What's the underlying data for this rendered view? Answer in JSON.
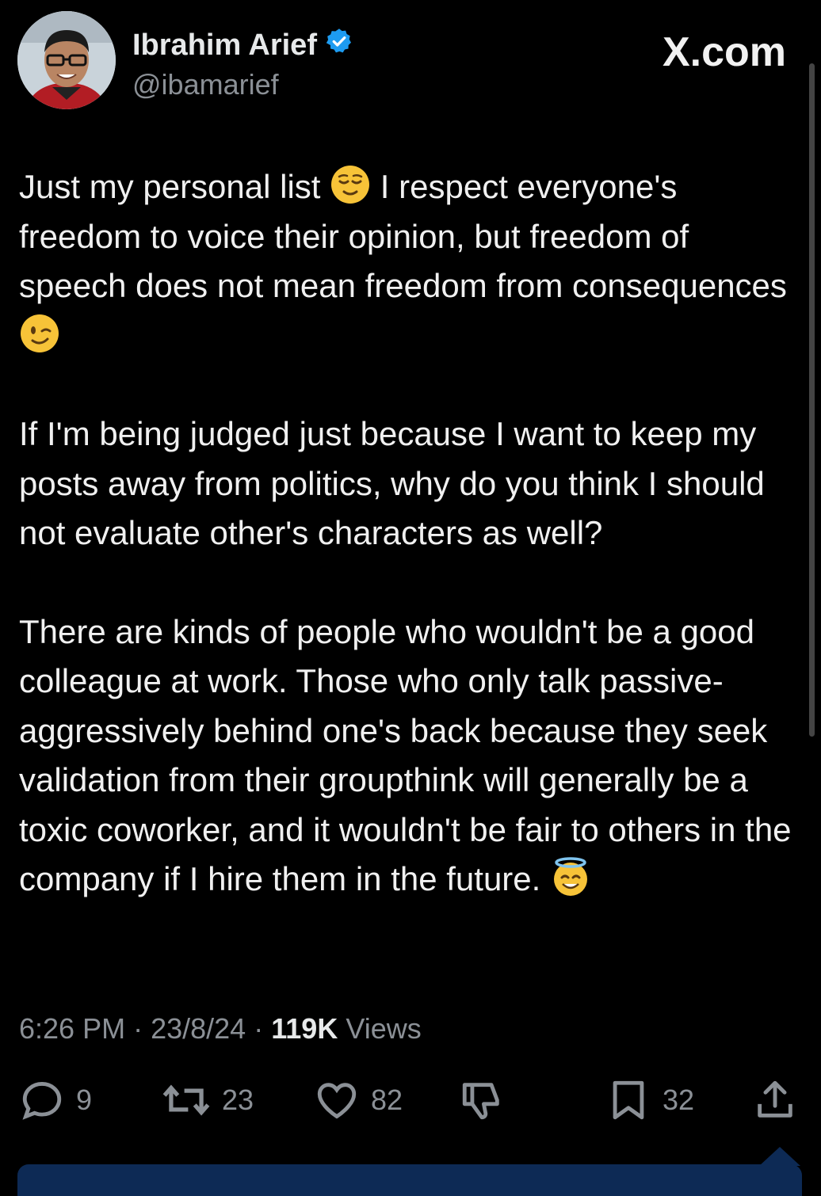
{
  "header": {
    "display_name": "Ibrahim Arief",
    "handle": "@ibamarief",
    "site": "X.com",
    "verified_color": "#1d9bf0"
  },
  "tweet": {
    "paragraphs": [
      {
        "text": "Just my personal list ",
        "emoji": "relieved-face",
        "text2": " I respect everyone's freedom to voice their opinion, but freedom of speech does not mean freedom from consequences ",
        "emoji2": "winking-face"
      },
      {
        "text": "If I'm being judged just because I want to keep my posts away from politics, why do you think I should not evaluate other's characters as well?"
      },
      {
        "text": "There are kinds of people who wouldn't be a good colleague at work. Those who only talk passive-aggressively behind one's back because they seek validation from their groupthink will generally be a toxic coworker, and it wouldn't be fair to others in the company if I hire them in the future. ",
        "emoji": "smiling-face-with-halo"
      }
    ]
  },
  "meta": {
    "time": "6:26 PM",
    "date": "23/8/24",
    "views_count": "119K",
    "views_label": "Views"
  },
  "actions": {
    "replies": "9",
    "reposts": "23",
    "likes": "82",
    "bookmarks": "32"
  },
  "colors": {
    "background": "#000000",
    "text": "#e7e9ea",
    "muted": "#8b9096",
    "accent": "#1d9bf0"
  }
}
